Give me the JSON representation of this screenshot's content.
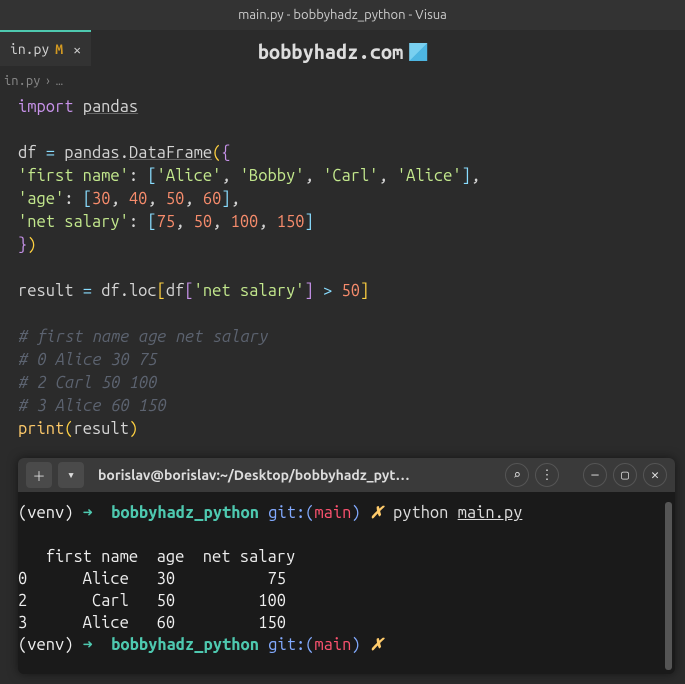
{
  "title_bar": "main.py - bobbyhadz_python - Visua",
  "tab": {
    "name": "in.py",
    "git_indicator": "M"
  },
  "watermark": "bobbyhadz.com",
  "breadcrumb": {
    "file": "in.py",
    "sep": "›",
    "more": "…"
  },
  "code_tokens": {
    "import": "import",
    "pandas": "pandas",
    "df": "df",
    "eq": "=",
    "dot": ".",
    "DataFrame": "DataFrame",
    "first_name": "'first name'",
    "list_fn": "['Alice', 'Bobby', 'Carl', 'Alice'],",
    "age": "'age'",
    "list_age_o": "[",
    "n30": "30",
    "n40": "40",
    "n50": "50",
    "n60": "60",
    "list_age_c": "],",
    "salary": "'net salary'",
    "list_sal_o": "[",
    "n75": "75",
    "n50b": "50",
    "n100": "100",
    "n150": "150",
    "list_sal_c": "]",
    "result": "result",
    "loc": "loc",
    "gt": ">",
    "f50": "50",
    "c1": "#   first name  age  net salary",
    "c2": "# 0      Alice   30          75",
    "c3": "# 2       Carl   50         100",
    "c4": "# 3      Alice   60         150",
    "print": "print"
  },
  "terminal": {
    "title": "borislav@borislav:~/Desktop/bobbyhadz_pyt…",
    "venv": "(venv)",
    "arrow": "➜",
    "path": "bobbyhadz_python",
    "git_pre": "git:(",
    "branch": "main",
    "git_post": ")",
    "dirty": "✗",
    "command": "python",
    "command_arg": "main.py",
    "out_h": "   first name  age  net salary",
    "out_r1": "0      Alice   30          75",
    "out_r2": "2       Carl   50         100",
    "out_r3": "3      Alice   60         150"
  }
}
